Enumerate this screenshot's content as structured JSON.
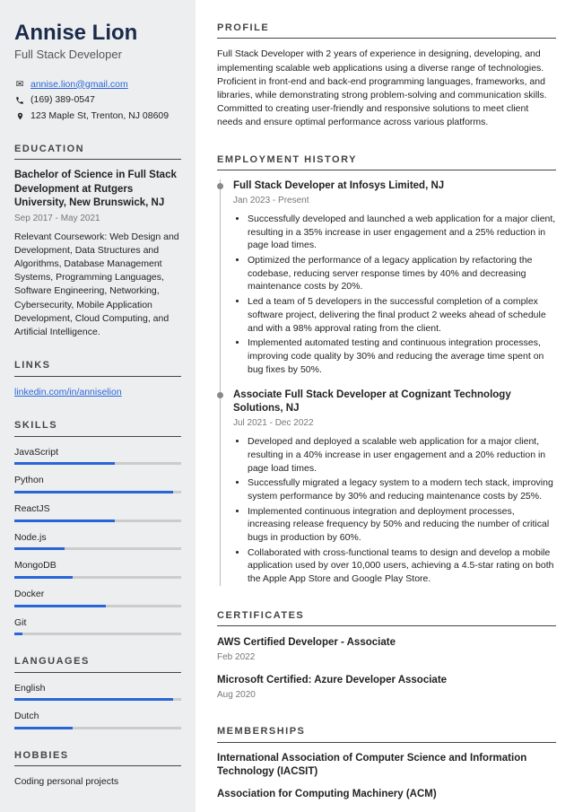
{
  "name": "Annise Lion",
  "title": "Full Stack Developer",
  "contact": {
    "email": "annise.lion@gmail.com",
    "phone": "(169) 389-0547",
    "address": "123 Maple St, Trenton, NJ 08609"
  },
  "headings": {
    "education": "EDUCATION",
    "links": "LINKS",
    "skills": "SKILLS",
    "languages": "LANGUAGES",
    "hobbies": "HOBBIES",
    "profile": "PROFILE",
    "employment": "EMPLOYMENT HISTORY",
    "certificates": "CERTIFICATES",
    "memberships": "MEMBERSHIPS"
  },
  "education": {
    "degree": "Bachelor of Science in Full Stack Development at Rutgers University, New Brunswick, NJ",
    "dates": "Sep 2017 - May 2021",
    "desc": "Relevant Coursework: Web Design and Development, Data Structures and Algorithms, Database Management Systems, Programming Languages, Software Engineering, Networking, Cybersecurity, Mobile Application Development, Cloud Computing, and Artificial Intelligence."
  },
  "links": {
    "linkedin": "linkedin.com/in/anniselion"
  },
  "skills": [
    {
      "name": "JavaScript",
      "level": 60
    },
    {
      "name": "Python",
      "level": 95
    },
    {
      "name": "ReactJS",
      "level": 60
    },
    {
      "name": "Node.js",
      "level": 30
    },
    {
      "name": "MongoDB",
      "level": 35
    },
    {
      "name": "Docker",
      "level": 55
    },
    {
      "name": "Git",
      "level": 5
    }
  ],
  "languages": [
    {
      "name": "English",
      "level": 95
    },
    {
      "name": "Dutch",
      "level": 35
    }
  ],
  "hobbies": [
    "Coding personal projects"
  ],
  "profile": "Full Stack Developer with 2 years of experience in designing, developing, and implementing scalable web applications using a diverse range of technologies. Proficient in front-end and back-end programming languages, frameworks, and libraries, while demonstrating strong problem-solving and communication skills. Committed to creating user-friendly and responsive solutions to meet client needs and ensure optimal performance across various platforms.",
  "jobs": [
    {
      "title": "Full Stack Developer at Infosys Limited, NJ",
      "dates": "Jan 2023 - Present",
      "bullets": [
        "Successfully developed and launched a web application for a major client, resulting in a 35% increase in user engagement and a 25% reduction in page load times.",
        "Optimized the performance of a legacy application by refactoring the codebase, reducing server response times by 40% and decreasing maintenance costs by 20%.",
        "Led a team of 5 developers in the successful completion of a complex software project, delivering the final product 2 weeks ahead of schedule and with a 98% approval rating from the client.",
        "Implemented automated testing and continuous integration processes, improving code quality by 30% and reducing the average time spent on bug fixes by 50%."
      ]
    },
    {
      "title": "Associate Full Stack Developer at Cognizant Technology Solutions, NJ",
      "dates": "Jul 2021 - Dec 2022",
      "bullets": [
        "Developed and deployed a scalable web application for a major client, resulting in a 40% increase in user engagement and a 20% reduction in page load times.",
        "Successfully migrated a legacy system to a modern tech stack, improving system performance by 30% and reducing maintenance costs by 25%.",
        "Implemented continuous integration and deployment processes, increasing release frequency by 50% and reducing the number of critical bugs in production by 60%.",
        "Collaborated with cross-functional teams to design and develop a mobile application used by over 10,000 users, achieving a 4.5-star rating on both the Apple App Store and Google Play Store."
      ]
    }
  ],
  "certificates": [
    {
      "title": "AWS Certified Developer - Associate",
      "date": "Feb 2022"
    },
    {
      "title": "Microsoft Certified: Azure Developer Associate",
      "date": "Aug 2020"
    }
  ],
  "memberships": [
    "International Association of Computer Science and Information Technology (IACSIT)",
    "Association for Computing Machinery (ACM)"
  ]
}
